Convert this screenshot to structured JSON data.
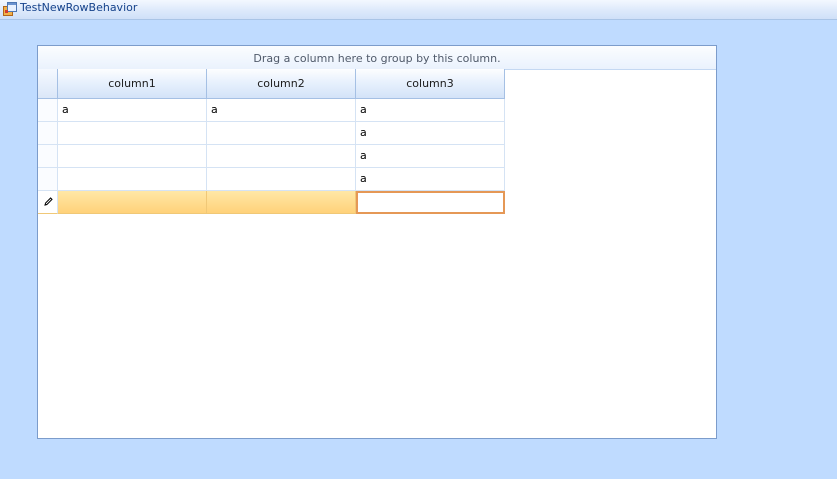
{
  "window": {
    "title": "TestNewRowBehavior",
    "icon": "app-form-icon"
  },
  "grid": {
    "group_panel_text": "Drag a column here to group by this column.",
    "columns": [
      "column1",
      "column2",
      "column3"
    ],
    "rows": [
      [
        "a",
        "a",
        "a"
      ],
      [
        "",
        "",
        "a"
      ],
      [
        "",
        "",
        "a"
      ],
      [
        "",
        "",
        "a"
      ]
    ],
    "new_row": {
      "indicator_icon": "pencil-icon",
      "values": [
        "",
        "",
        ""
      ],
      "editing_column": "column3"
    }
  },
  "colors": {
    "window_bg": "#bfdbff",
    "new_row": "#ffd27a",
    "edit_border": "#e59856",
    "title_text": "#15428b"
  }
}
